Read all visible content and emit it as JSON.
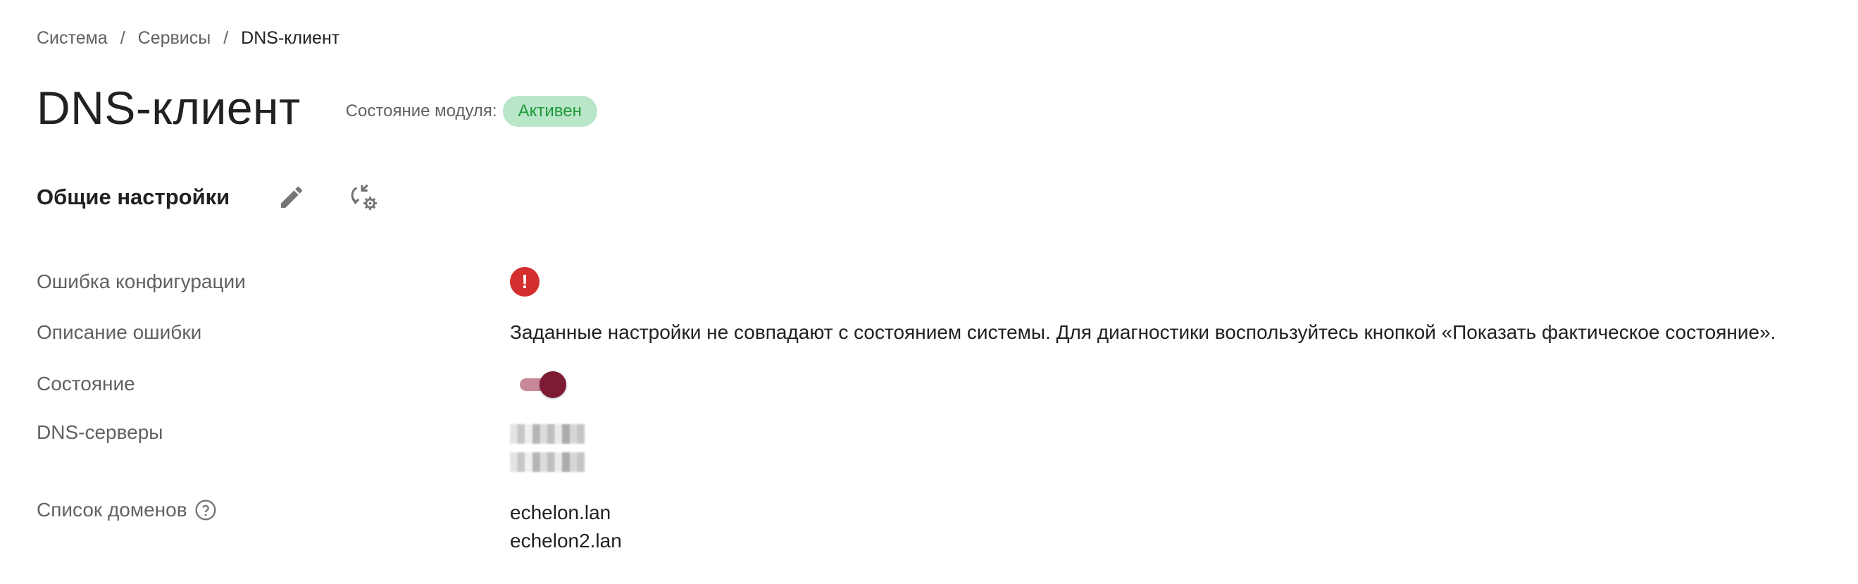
{
  "breadcrumb": {
    "items": [
      "Система",
      "Сервисы"
    ],
    "separator": "/",
    "current": "DNS-клиент"
  },
  "page": {
    "title": "DNS-клиент",
    "module_state_label": "Состояние модуля:",
    "module_state_value": "Активен"
  },
  "section": {
    "title": "Общие настройки",
    "edit_icon": "pencil-icon",
    "reload_icon": "sync-settings-icon"
  },
  "rows": {
    "config_error": {
      "label": "Ошибка конфигурации",
      "icon": "error-icon",
      "glyph": "!"
    },
    "error_description": {
      "label": "Описание ошибки",
      "value": "Заданные настройки не совпадают с состоянием системы. Для диагностики воспользуйтесь кнопкой «Показать фактическое состояние»."
    },
    "state": {
      "label": "Состояние",
      "enabled": true
    },
    "dns_servers": {
      "label": "DNS-серверы"
    },
    "domains": {
      "label": "Список доменов",
      "items": [
        "echelon.lan",
        "echelon2.lan"
      ]
    }
  },
  "colors": {
    "badge_bg": "#b9e6c9",
    "badge_text": "#1e9a3a",
    "error": "#d32f2f",
    "toggle_thumb": "#7d1a34",
    "toggle_track": "#c7899a"
  }
}
